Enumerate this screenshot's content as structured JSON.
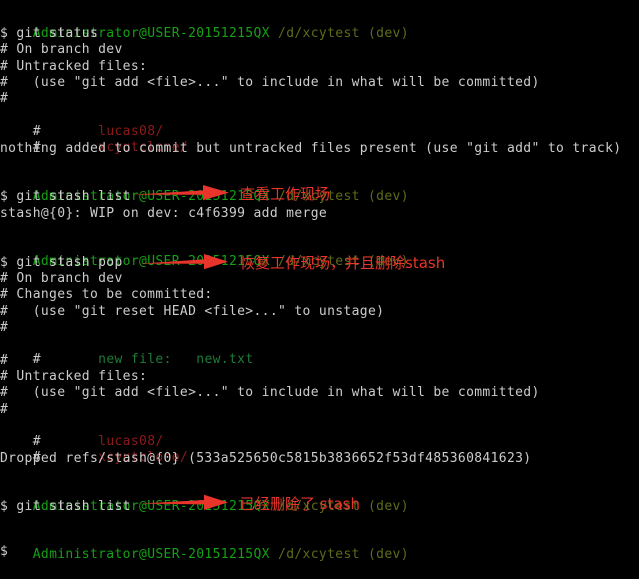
{
  "terminal": {
    "background_color": "#000000",
    "prompt_user_color": "#15a015",
    "prompt_path_color": "#5f6b1a",
    "output_color": "#cccccc",
    "untracked_color": "#8b1a1a",
    "staged_color": "#1f7a37",
    "annotation_color": "#e8342a",
    "prompt_user": "Administrator@USER-20151215QX",
    "prompt_path": "/d/xcytest",
    "prompt_branch": "(dev)",
    "lines": [
      {
        "id": "l01",
        "type": "prompt"
      },
      {
        "id": "l02",
        "type": "command",
        "text": "$ git status"
      },
      {
        "id": "l03",
        "type": "output",
        "text": "# On branch dev"
      },
      {
        "id": "l04",
        "type": "output",
        "text": "# Untracked files:"
      },
      {
        "id": "l05",
        "type": "output",
        "text": "#   (use \"git add <file>...\" to include in what will be committed)"
      },
      {
        "id": "l06",
        "type": "output",
        "text": "#"
      },
      {
        "id": "l07",
        "type": "untracked",
        "hash": "#",
        "file": "lucas08/"
      },
      {
        "id": "l08",
        "type": "untracked",
        "hash": "#",
        "file": "xcyutclone/"
      },
      {
        "id": "l09",
        "type": "output",
        "text": "nothing added to commit but untracked files present (use \"git add\" to track)"
      },
      {
        "id": "l10",
        "type": "blank",
        "text": ""
      },
      {
        "id": "l11",
        "type": "prompt"
      },
      {
        "id": "l12",
        "type": "command",
        "text": "$ git stash list"
      },
      {
        "id": "l13",
        "type": "output",
        "text": "stash@{0}: WIP on dev: c4f6399 add merge"
      },
      {
        "id": "l14",
        "type": "blank",
        "text": ""
      },
      {
        "id": "l15",
        "type": "prompt"
      },
      {
        "id": "l16",
        "type": "command",
        "text": "$ git stash pop"
      },
      {
        "id": "l17",
        "type": "output",
        "text": "# On branch dev"
      },
      {
        "id": "l18",
        "type": "output",
        "text": "# Changes to be committed:"
      },
      {
        "id": "l19",
        "type": "output",
        "text": "#   (use \"git reset HEAD <file>...\" to unstage)"
      },
      {
        "id": "l20",
        "type": "output",
        "text": "#"
      },
      {
        "id": "l21",
        "type": "staged",
        "hash": "#",
        "file": "new file:   new.txt"
      },
      {
        "id": "l22",
        "type": "output",
        "text": "#"
      },
      {
        "id": "l23",
        "type": "output",
        "text": "# Untracked files:"
      },
      {
        "id": "l24",
        "type": "output",
        "text": "#   (use \"git add <file>...\" to include in what will be committed)"
      },
      {
        "id": "l25",
        "type": "output",
        "text": "#"
      },
      {
        "id": "l26",
        "type": "untracked",
        "hash": "#",
        "file": "lucas08/"
      },
      {
        "id": "l27",
        "type": "untracked",
        "hash": "#",
        "file": "xcyutclone/"
      },
      {
        "id": "l28",
        "type": "output",
        "text": "Dropped refs/stash@{0} (533a525650c5815b3836652f53df485360841623)"
      },
      {
        "id": "l29",
        "type": "blank",
        "text": ""
      },
      {
        "id": "l30",
        "type": "prompt"
      },
      {
        "id": "l31",
        "type": "command",
        "text": "$ git stash list"
      },
      {
        "id": "l32",
        "type": "blank",
        "text": ""
      },
      {
        "id": "l33",
        "type": "prompt"
      },
      {
        "id": "l34",
        "type": "command",
        "text": "$"
      }
    ]
  },
  "annotations": [
    {
      "id": "a1",
      "text": "查看工作现场",
      "arrow": "arrow-right-icon"
    },
    {
      "id": "a2",
      "text": "恢复工作现场，并且删除stash",
      "arrow": "arrow-right-icon"
    },
    {
      "id": "a3",
      "text": "已经删除了 stash",
      "arrow": "arrow-right-icon"
    }
  ]
}
